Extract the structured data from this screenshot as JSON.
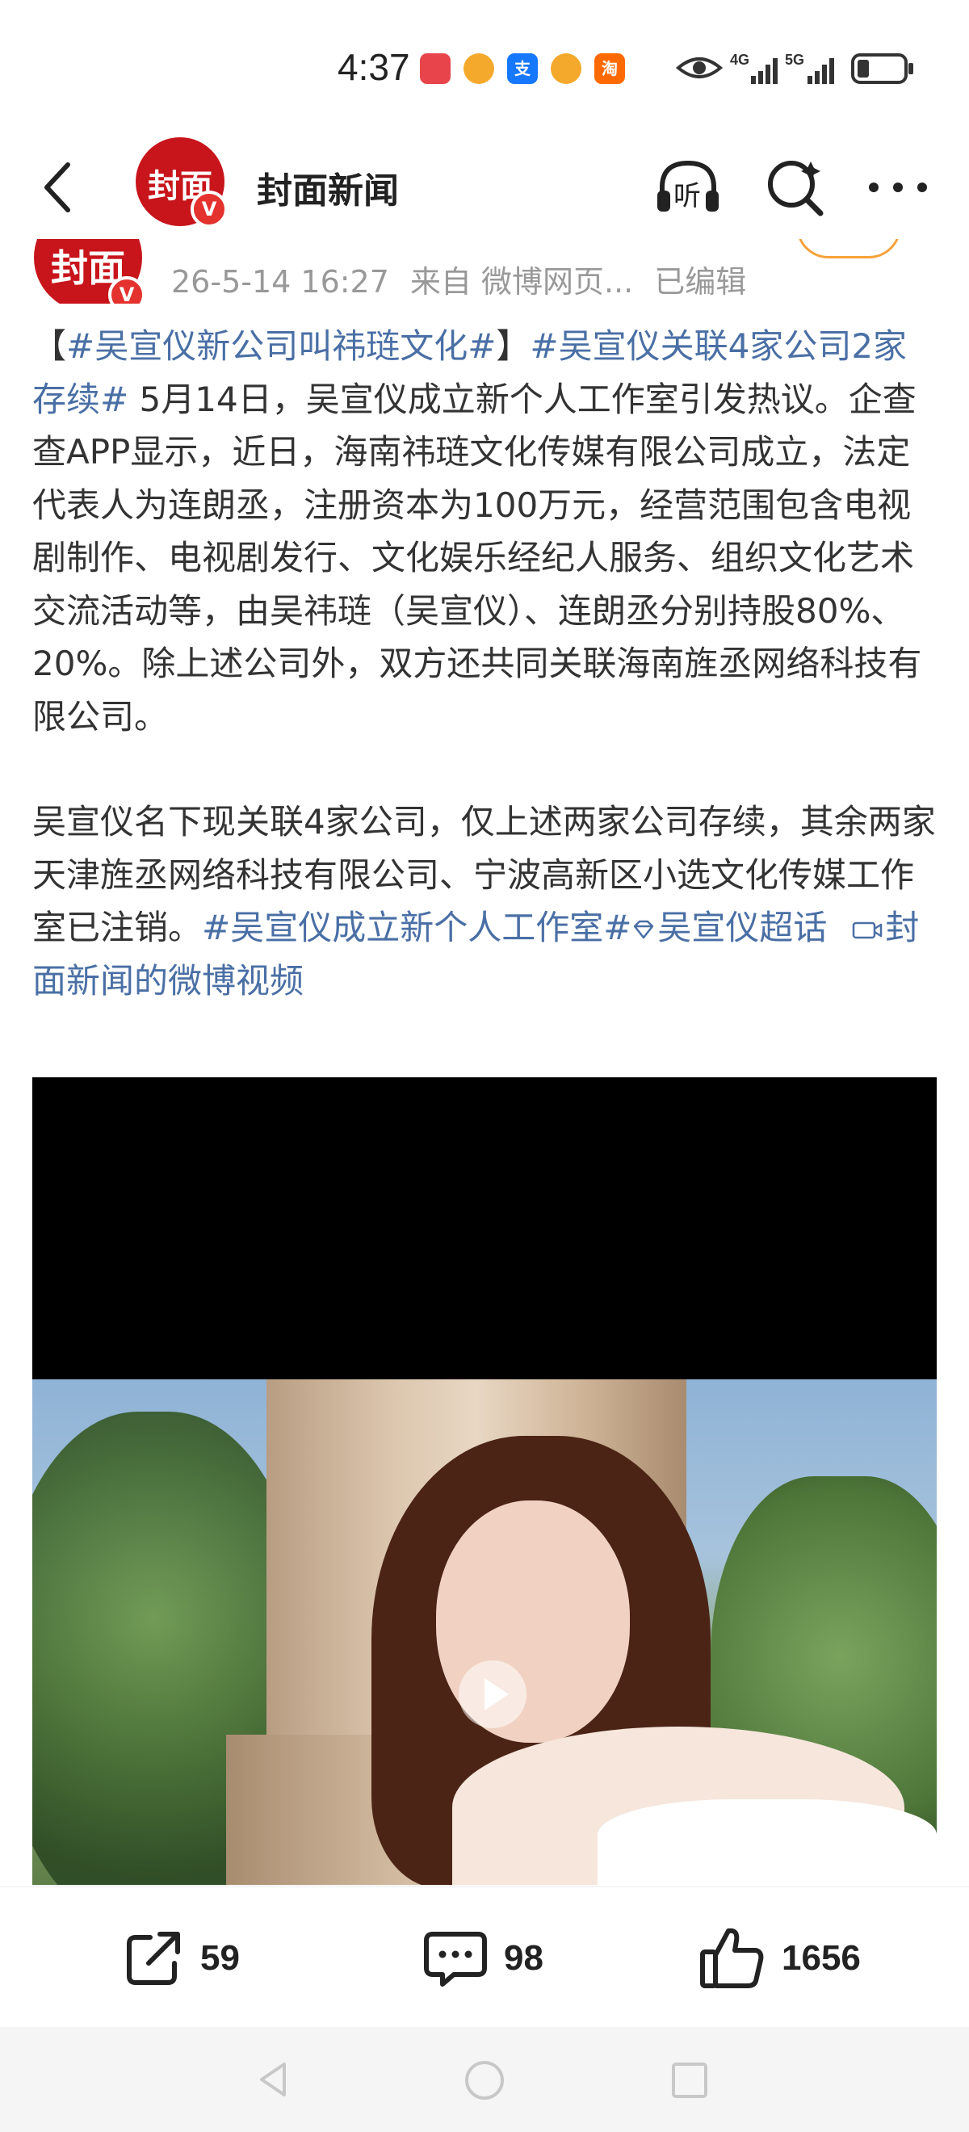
{
  "status_bar": {
    "time": "4:37",
    "network": [
      "4G",
      "5G"
    ],
    "apps": [
      {
        "icon": "huawei-app-icon",
        "color": "#e8444c"
      },
      {
        "icon": "weibo-icon",
        "color": "#f4a92c"
      },
      {
        "icon": "alipay-icon",
        "color": "#1677ff",
        "glyph": "支"
      },
      {
        "icon": "weibo-icon",
        "color": "#f4a92c"
      },
      {
        "icon": "taobao-icon",
        "color": "#ff6a00",
        "glyph": "淘"
      }
    ]
  },
  "header": {
    "title": "封面新闻",
    "avatar_text": "封面",
    "verified_badge": "V",
    "actions": [
      "listen-icon",
      "search-icon",
      "more-icon"
    ]
  },
  "post": {
    "avatar_text": "封面",
    "date": "26-5-14 16:27",
    "source": "来自 微博网页...",
    "edited": "已编辑",
    "p1": {
      "bracket_open": "【",
      "tag1": "#吴宣仪新公司叫祎琏文化#",
      "bracket_close": "】",
      "tag2": "#吴宣仪关联4家公司2家存续#",
      "text": " 5月14日，吴宣仪成立新个人工作室引发热议。企查查APP显示，近日，海南祎琏文化传媒有限公司成立，法定代表人为连朗丞，注册资本为100万元，经营范围包含电视剧制作、电视剧发行、文化娱乐经纪人服务、组织文化艺术交流活动等，由吴祎琏（吴宣仪）、连朗丞分别持股80%、20%。除上述公司外，双方还共同关联海南旌丞网络科技有限公司。"
    },
    "p2": {
      "text": "吴宣仪名下现关联4家公司，仅上述两家公司存续，其余两家天津旌丞网络科技有限公司、宁波高新区小选文化传媒工作室已注销。",
      "tag3": "#吴宣仪成立新个人工作室#",
      "supertopic": "吴宣仪超话",
      "video_link": "封面新闻的微博视频"
    }
  },
  "actions": {
    "share_count": "59",
    "comment_count": "98",
    "like_count": "1656"
  },
  "colors": {
    "link": "#4a6fa5",
    "brand_red": "#c8141b",
    "follow_border": "#f6a23a"
  }
}
